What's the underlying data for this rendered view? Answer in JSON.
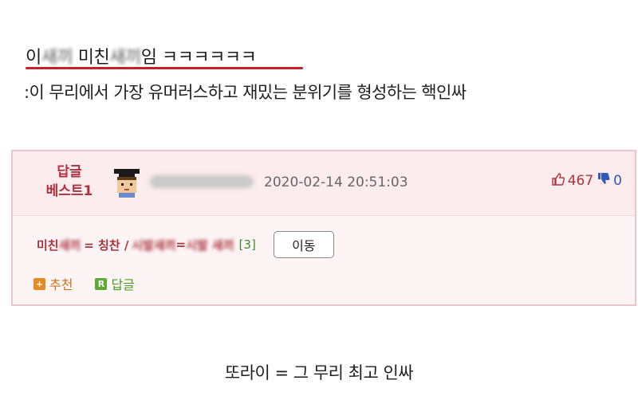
{
  "headline": {
    "prefix": "이",
    "blur1": "새끼",
    "mid": " 미친",
    "blur2": "새끼",
    "suffix": "임 ㅋㅋㅋㅋㅋㅋ"
  },
  "description": ":이 무리에서 가장 유머러스하고 재밌는 분위기를 형성하는 핵인싸",
  "comment": {
    "rank_line1": "답글",
    "rank_line2": "베스트1",
    "date": "2020-02-14 20:51:03",
    "upvotes": "467",
    "downvotes": "0",
    "text_part1": "미친 ",
    "text_blur1": "새끼",
    "text_part2": " = 칭찬 / ",
    "text_blur2": "시발",
    "text_blur3": " 새끼",
    "text_part3": " = ",
    "text_blur4": "시발 새끼",
    "reply_count": "[3]",
    "move_button": "이동",
    "recommend_label": "추천",
    "reply_label": "답글",
    "recommend_icon": "+",
    "reply_icon": "R"
  },
  "footer": "또라이 = 그 무리 최고 인싸",
  "colors": {
    "underline": "#c8202a",
    "rank": "#b0303e",
    "card_border": "#e9c7cc"
  }
}
